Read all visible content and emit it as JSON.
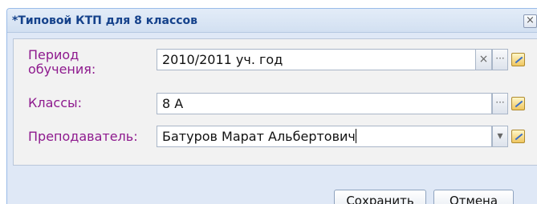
{
  "dialog": {
    "title": "*Типовой КТП для 8 классов",
    "close_glyph": "×"
  },
  "form": {
    "period": {
      "label_line1": "Период",
      "label_line2": "обучения:",
      "value": "2010/2011 уч. год",
      "clear_glyph": "×",
      "select_glyph": "···"
    },
    "classes": {
      "label": "Классы:",
      "value": "8 А",
      "select_glyph": "···"
    },
    "teacher": {
      "label": "Преподаватель:",
      "value": "Батуров Марат Альбертович",
      "dropdown_glyph": "▾"
    }
  },
  "buttons": {
    "save_label": "Сохранить",
    "cancel_label": "Отмена"
  },
  "icons": {
    "edit": "edit-icon",
    "close": "close-icon",
    "clear": "clear-icon",
    "ellipsis": "ellipsis-icon",
    "dropdown": "chevron-down-icon"
  }
}
